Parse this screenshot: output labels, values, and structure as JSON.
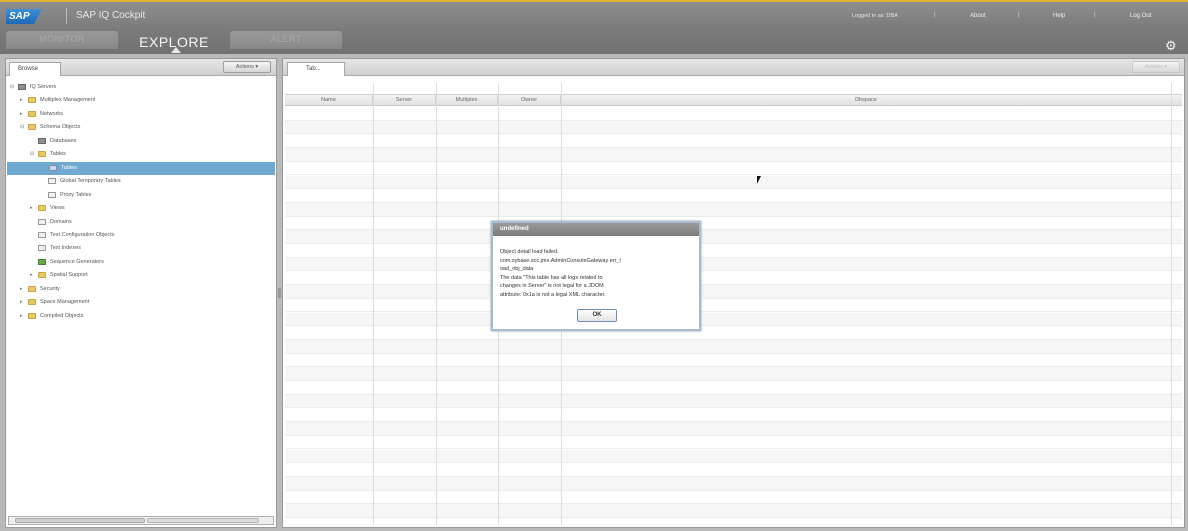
{
  "header": {
    "logo_text": "SAP",
    "app_title": "SAP IQ Cockpit",
    "user_info": "Logged in as: DBA",
    "links": [
      "About",
      "Help",
      "Log Out"
    ],
    "separator": "|"
  },
  "nav": {
    "tabs": [
      "MONITOR",
      "EXPLORE",
      "ALERT"
    ],
    "active": "EXPLORE"
  },
  "left_panel": {
    "tab_label": "Browse",
    "actions_label": "Actions ▾",
    "tree": [
      {
        "label": "IQ Servers",
        "toggle": "⊟",
        "icon": "server-icon"
      },
      {
        "label": "Multiplex Management",
        "toggle": "▸",
        "icon": "folder-icon"
      },
      {
        "label": "Networks",
        "toggle": "▸",
        "icon": "folder-icon"
      },
      {
        "label": "Schema Objects",
        "toggle": "⊟",
        "icon": "folder-icon"
      },
      {
        "label": "Databases",
        "toggle": "",
        "icon": "database-icon"
      },
      {
        "label": "Tables",
        "toggle": "⊟",
        "icon": "folder-icon"
      },
      {
        "label": "Tables",
        "toggle": "",
        "icon": "table-icon",
        "selected": true
      },
      {
        "label": "Global Temporary Tables",
        "toggle": "",
        "icon": "temp-table-icon"
      },
      {
        "label": "Proxy Tables",
        "toggle": "",
        "icon": "proxy-table-icon"
      },
      {
        "label": "Views",
        "toggle": "▸",
        "icon": "folder-icon"
      },
      {
        "label": "Domains",
        "toggle": "",
        "icon": "domain-icon"
      },
      {
        "label": "Text Configuration Objects",
        "toggle": "",
        "icon": "text-config-icon"
      },
      {
        "label": "Text Indexes",
        "toggle": "",
        "icon": "text-index-icon"
      },
      {
        "label": "Sequence Generators",
        "toggle": "",
        "icon": "sequence-icon"
      },
      {
        "label": "Spatial Support",
        "toggle": "▸",
        "icon": "folder-icon"
      },
      {
        "label": "Security",
        "toggle": "▸",
        "icon": "folder-icon"
      },
      {
        "label": "Space Management",
        "toggle": "▸",
        "icon": "folder-icon"
      },
      {
        "label": "Compiled Objects",
        "toggle": "▸",
        "icon": "folder-icon"
      }
    ]
  },
  "right_panel": {
    "tab_label": "Tab...",
    "actions_label": "Actions ▾",
    "columns": [
      "Name",
      "Server",
      "Multiplex",
      "Owner",
      "Dbspace"
    ]
  },
  "dialog": {
    "title": "undefined",
    "lines": [
      "Object detail load failed.",
      "com.sybase.scc.jmx.AdminConsoleGateway err_l",
      "oad_obj_data",
      "The data \"This table has all logs related to",
      "changes in Server\" is not legal for a JDOM",
      "attribute: 0x1a is not a legal XML character."
    ],
    "ok_label": "OK"
  }
}
